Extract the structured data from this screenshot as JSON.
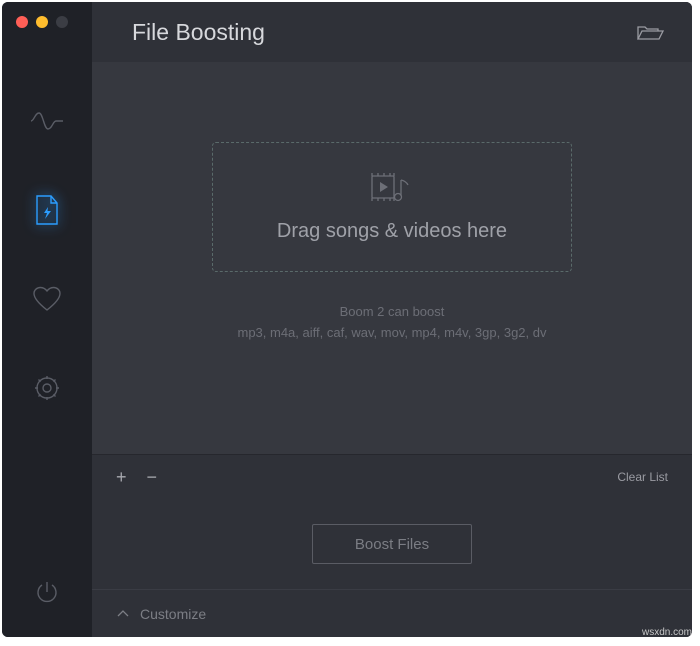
{
  "window": {
    "title": "File Boosting"
  },
  "dropzone": {
    "text": "Drag songs & videos here"
  },
  "supports": {
    "line1": "Boom 2 can boost",
    "line2": "mp3, m4a, aiff, caf, wav, mov, mp4, m4v, 3gp, 3g2, dv"
  },
  "controls": {
    "plus": "+",
    "minus": "−",
    "clear": "Clear List"
  },
  "boost": {
    "label": "Boost Files"
  },
  "customize": {
    "label": "Customize"
  },
  "watermark": "wsxdn.com"
}
